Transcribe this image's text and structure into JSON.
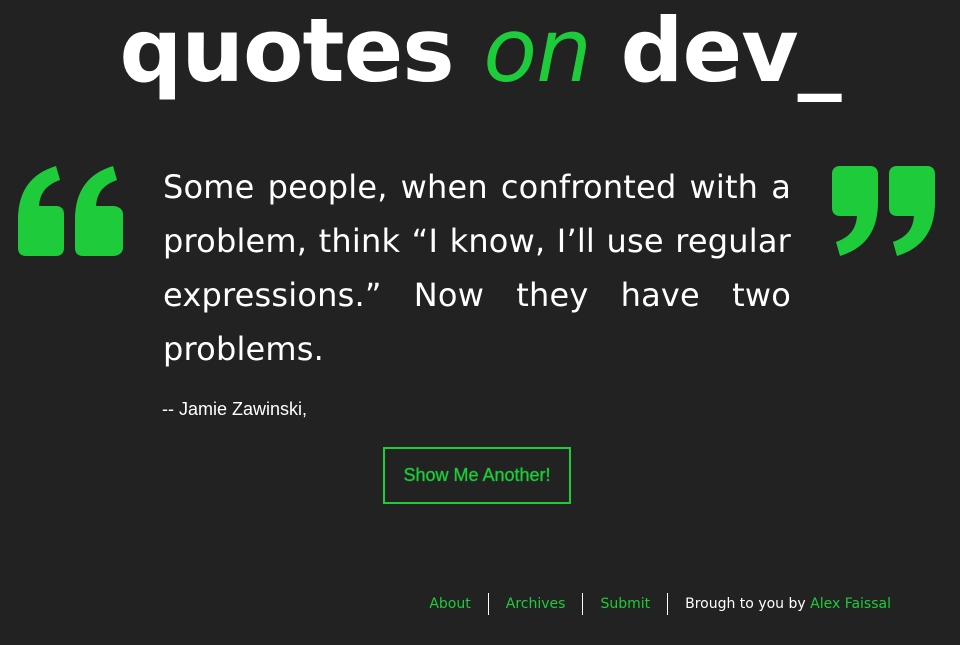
{
  "logo": {
    "part1": "quotes",
    "part2": "on",
    "part3": "dev_"
  },
  "quote": {
    "text": "Some people, when confronted with a problem, think “I know, I’ll use regular expressions.” Now they have two problems.",
    "author": "-- Jamie Zawinski,"
  },
  "button": {
    "label": "Show Me Another!"
  },
  "footer": {
    "links": [
      "About",
      "Archives",
      "Submit"
    ],
    "credit_prefix": "Brough to you by ",
    "credit_name": "Alex Faissal"
  },
  "colors": {
    "background": "#222222",
    "accent": "#1ecb3a",
    "text": "#ffffff"
  },
  "icons": {
    "open_quote": "open-quote-icon",
    "close_quote": "close-quote-icon"
  }
}
